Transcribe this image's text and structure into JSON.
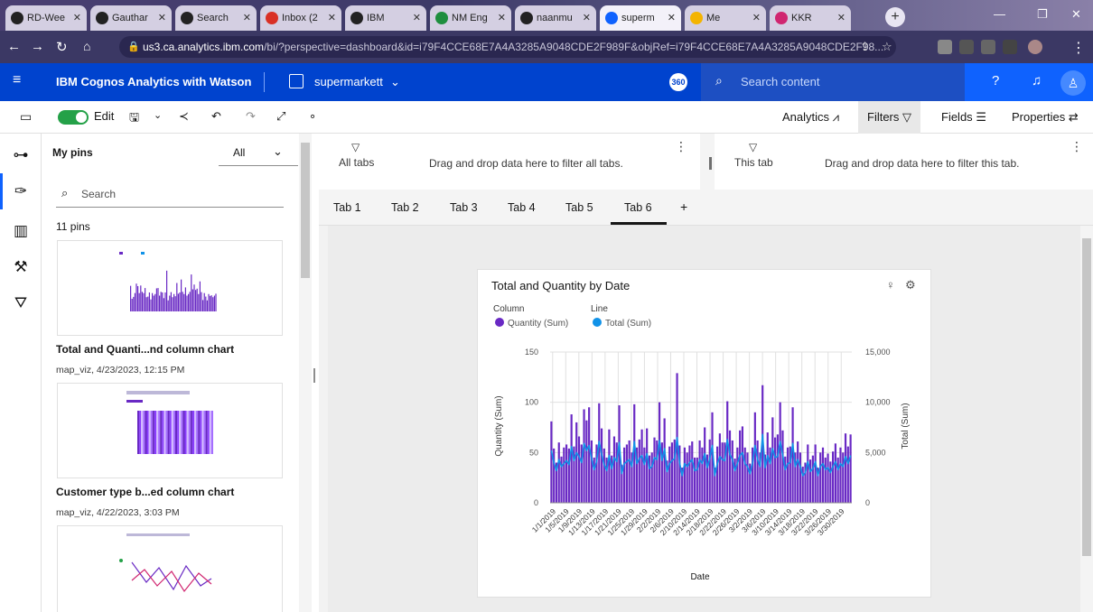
{
  "browser": {
    "tabs": [
      {
        "label": "RD-Wee",
        "color": "#222"
      },
      {
        "label": "Gauthar",
        "color": "#222"
      },
      {
        "label": "Search",
        "color": "#222"
      },
      {
        "label": "Inbox (2",
        "color": "#d93025"
      },
      {
        "label": "IBM",
        "color": "#222"
      },
      {
        "label": "NM Eng",
        "color": "#1e8e3e"
      },
      {
        "label": "naanmu",
        "color": "#222"
      },
      {
        "label": "superm",
        "color": "#0f62fe"
      },
      {
        "label": "Me",
        "color": "#f4b400"
      },
      {
        "label": "KKR",
        "color": "#d02670"
      }
    ],
    "url_host": "us3.ca.analytics.ibm.com",
    "url_path": "/bi/?perspective=dashboard&id=i79F4CCE68E7A4A3285A9048CDE2F989F&objRef=i79F4CCE68E7A4A3285A9048CDE2F98..."
  },
  "app": {
    "product": "IBM Cognos Analytics with Watson",
    "dashboard_name": "supermarkett",
    "badge": "360",
    "search_placeholder": "Search content"
  },
  "toolbar": {
    "edit_label": "Edit",
    "analytics_label": "Analytics",
    "filters_label": "Filters",
    "fields_label": "Fields",
    "properties_label": "Properties"
  },
  "pins_panel": {
    "title": "My pins",
    "filter_value": "All",
    "search_placeholder": "Search",
    "count": "11 pins",
    "items": [
      {
        "title": "Total and Quanti...nd column chart",
        "meta": "map_viz, 4/23/2023, 12:15 PM"
      },
      {
        "title": "Customer type b...ed column chart",
        "meta": "map_viz, 4/22/2023, 3:03 PM"
      }
    ]
  },
  "filter_area": {
    "all_tabs_label": "All tabs",
    "all_tabs_hint": "Drag and drop data here to filter all tabs.",
    "this_tab_label": "This tab",
    "this_tab_hint": "Drag and drop data here to filter this tab."
  },
  "dashboard_tabs": [
    "Tab 1",
    "Tab 2",
    "Tab 3",
    "Tab 4",
    "Tab 5",
    "Tab 6"
  ],
  "active_tab": "Tab 6",
  "chart_data": {
    "type": "bar",
    "title": "Total and Quantity by Date",
    "legend": {
      "column_heading": "Column",
      "line_heading": "Line",
      "position": "top-left"
    },
    "xlabel": "Date",
    "ylabel_left": "Quantity (Sum)",
    "ylabel_right": "Total (Sum)",
    "ylim_left": [
      0,
      150
    ],
    "ylim_right": [
      0,
      15000
    ],
    "yticks_left": [
      "0",
      "50",
      "100",
      "150"
    ],
    "yticks_right": [
      "0",
      "5,000",
      "10,000",
      "15,000"
    ],
    "xtick_labels": [
      "1/1/2019",
      "1/5/2019",
      "1/9/2019",
      "1/13/2019",
      "1/17/2019",
      "1/21/2019",
      "1/25/2019",
      "1/29/2019",
      "2/2/2019",
      "2/6/2019",
      "2/10/2019",
      "2/14/2019",
      "2/18/2019",
      "2/22/2019",
      "2/26/2019",
      "3/2/2019",
      "3/6/2019",
      "3/10/2019",
      "3/14/2019",
      "3/18/2019",
      "3/22/2019",
      "3/26/2019",
      "3/30/2019"
    ],
    "series": [
      {
        "name": "Quantity (Sum)",
        "kind": "column",
        "axis": "left",
        "color": "#6929c4",
        "values": [
          81,
          54,
          40,
          60,
          46,
          55,
          58,
          54,
          88,
          56,
          80,
          66,
          58,
          93,
          82,
          95,
          62,
          45,
          58,
          99,
          74,
          54,
          45,
          73,
          47,
          66,
          60,
          97,
          38,
          55,
          58,
          62,
          50,
          98,
          55,
          63,
          73,
          55,
          74,
          47,
          50,
          65,
          62,
          100,
          60,
          84,
          42,
          56,
          60,
          63,
          129,
          57,
          35,
          55,
          50,
          57,
          61,
          45,
          45,
          62,
          55,
          75,
          48,
          63,
          90,
          35,
          56,
          69,
          60,
          60,
          101,
          72,
          62,
          44,
          55,
          72,
          76,
          55,
          50,
          39,
          55,
          90,
          62,
          50,
          117,
          48,
          70,
          55,
          85,
          65,
          68,
          100,
          72,
          46,
          55,
          56,
          95,
          50,
          61,
          50,
          36,
          40,
          58,
          43,
          47,
          58,
          35,
          50,
          55,
          45,
          49,
          41,
          51,
          59,
          45,
          55,
          50,
          69,
          56,
          68
        ]
      },
      {
        "name": "Total (Sum)",
        "kind": "line",
        "axis": "right",
        "color": "#1192e8",
        "values": [
          5200,
          4000,
          3200,
          4300,
          3600,
          3900,
          4200,
          3800,
          5600,
          4200,
          5000,
          4600,
          4000,
          5900,
          5200,
          5700,
          4400,
          3300,
          4100,
          6100,
          4800,
          3800,
          3200,
          4700,
          3400,
          4500,
          4100,
          6000,
          2900,
          3900,
          4100,
          4300,
          3600,
          6100,
          3900,
          4400,
          4700,
          3800,
          4900,
          3400,
          3600,
          4500,
          4300,
          6200,
          4200,
          5400,
          3100,
          3900,
          4200,
          4400,
          6500,
          4000,
          2700,
          3900,
          3600,
          4000,
          4300,
          3200,
          3300,
          4300,
          3900,
          4900,
          3500,
          4400,
          5700,
          2700,
          3900,
          4600,
          4300,
          4200,
          6300,
          4800,
          4300,
          3200,
          3900,
          4700,
          5000,
          3900,
          3600,
          2900,
          3900,
          5700,
          4300,
          3600,
          6800,
          3500,
          4700,
          3900,
          5400,
          4500,
          4600,
          6100,
          4800,
          3300,
          3900,
          4000,
          5900,
          3600,
          4300,
          3600,
          2700,
          3000,
          4100,
          3100,
          3400,
          4100,
          2700,
          3600,
          3900,
          3300,
          3500,
          3000,
          3600,
          4100,
          3300,
          3900,
          3600,
          4600,
          3900,
          4700
        ]
      }
    ]
  },
  "colors": {
    "ibm_blue": "#0f62fe",
    "ibm_blue_dark": "#0043ce",
    "quantity": "#6929c4",
    "total": "#1192e8",
    "toggle_green": "#24a148"
  },
  "icons": [
    "menu-icon",
    "dashboard-icon",
    "chevron-down-icon",
    "search-icon",
    "help-icon",
    "notification-icon",
    "user-icon",
    "comment-icon",
    "save-icon",
    "share-icon",
    "undo-icon",
    "redo-icon",
    "expand-icon",
    "pin-icon",
    "analytics-icon",
    "filter-icon",
    "fields-icon",
    "properties-icon",
    "sources-icon",
    "visualizations-icon",
    "widgets-icon",
    "assistant-icon",
    "overflow-menu-icon",
    "lightbulb-icon",
    "settings-icon"
  ]
}
